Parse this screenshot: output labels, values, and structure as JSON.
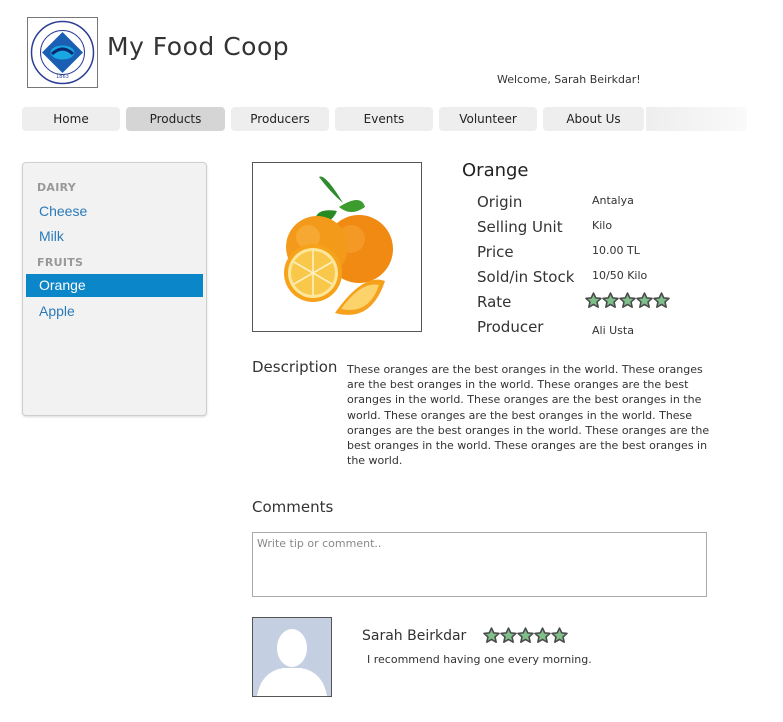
{
  "header": {
    "logo_text": "BOĞAZİÇİ ÜNİVERSİTESİ 1863",
    "title": "My Food Coop",
    "welcome": "Welcome, Sarah Beirkdar!"
  },
  "nav": {
    "items": [
      {
        "label": "Home"
      },
      {
        "label": "Products"
      },
      {
        "label": "Producers"
      },
      {
        "label": "Events"
      },
      {
        "label": "Volunteer"
      },
      {
        "label": "About Us"
      }
    ],
    "active": "Products"
  },
  "sidebar": {
    "categories": [
      {
        "name": "DAIRY",
        "items": [
          "Cheese",
          "Milk"
        ]
      },
      {
        "name": "FRUITS",
        "items": [
          "Orange",
          "Apple"
        ]
      }
    ],
    "selected": "Orange"
  },
  "product": {
    "name": "Orange",
    "details": [
      {
        "label": "Origin",
        "value": "Antalya"
      },
      {
        "label": "Selling Unit",
        "value": "Kilo"
      },
      {
        "label": "Price",
        "value": "10.00 TL"
      },
      {
        "label": "Sold/in Stock",
        "value": "10/50 Kilo"
      },
      {
        "label": "Rate",
        "value": ""
      },
      {
        "label": "Producer",
        "value": "Ali Usta"
      }
    ],
    "rating_stars": 5,
    "description_label": "Description",
    "description": "These oranges are the best oranges in the world. These oranges are the best oranges in the world. These oranges are the best oranges in the world. These oranges are the best oranges in the world. These oranges are the best oranges in the world. These oranges are the best oranges in the world. These oranges are the best oranges in the world. These oranges are the best oranges in the world."
  },
  "comments": {
    "label": "Comments",
    "placeholder": "Write tip or comment..",
    "items": [
      {
        "author": "Sarah Beirkdar",
        "stars": 5,
        "text": "I recommend having one every morning."
      }
    ]
  },
  "colors": {
    "accent": "#0a86c9",
    "link": "#2a7ab8",
    "nav_bg": "#eeeeee",
    "nav_active": "#d5d5d5",
    "star_fill": "#7fbf8a",
    "star_stroke": "#4a4a4a"
  }
}
